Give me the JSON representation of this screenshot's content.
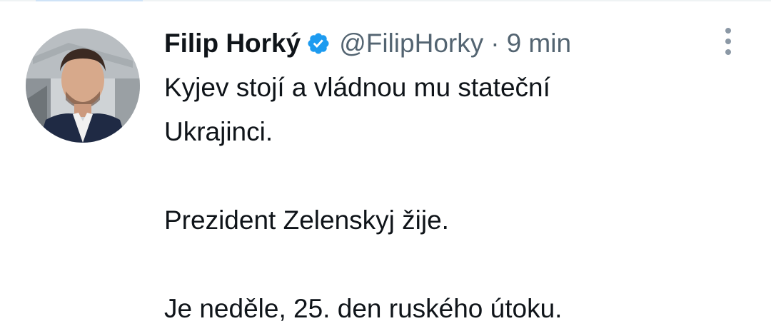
{
  "tweet": {
    "author": {
      "display_name": "Filip Horký",
      "handle": "@FilipHorky",
      "verified": true,
      "avatar": "profile-photo"
    },
    "separator": "·",
    "timestamp": "9 min",
    "more_icon": "more-options-icon",
    "text_lines": [
      "Kyjev stojí a vládnou mu stateční",
      "Ukrajinci.",
      "",
      "Prezident Zelenskyj žije.",
      "",
      "Je neděle, 25. den ruského útoku."
    ]
  },
  "colors": {
    "verified_badge": "#1d9bf0",
    "secondary_text": "#536471",
    "primary_text": "#0f1419"
  }
}
